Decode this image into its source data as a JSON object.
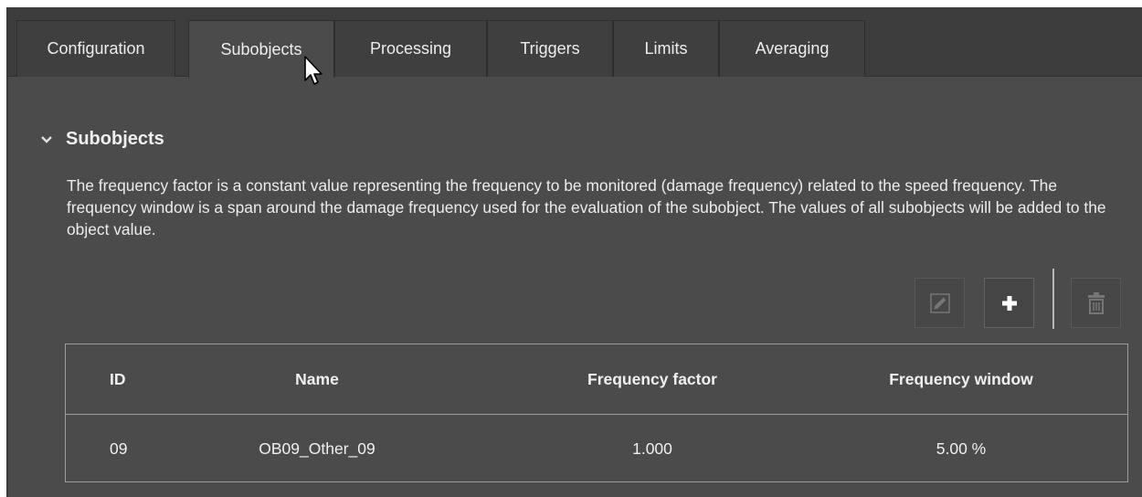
{
  "tabs": [
    {
      "label": "Configuration"
    },
    {
      "label": "Subobjects"
    },
    {
      "label": "Processing"
    },
    {
      "label": "Triggers"
    },
    {
      "label": "Limits"
    },
    {
      "label": "Averaging"
    }
  ],
  "active_tab": "Subobjects",
  "section": {
    "title": "Subobjects",
    "description": "The frequency factor is a constant value representing the frequency to be monitored (damage frequency) related to the speed frequency. The frequency window is a span around the damage frequency used for the evaluation of the subobject. The values of all subobjects will be added to the object value."
  },
  "toolbar": {
    "edit_icon": "pencil-icon",
    "add_icon": "plus-icon",
    "delete_icon": "trash-icon"
  },
  "table": {
    "headers": {
      "id": "ID",
      "name": "Name",
      "frequency_factor": "Frequency factor",
      "frequency_window": "Frequency window"
    },
    "rows": [
      {
        "id": "09",
        "name": "OB09_Other_09",
        "frequency_factor": "1.000",
        "frequency_window": "5.00 %"
      }
    ]
  },
  "colors": {
    "background": "#4b4b4b",
    "tabbar": "#3d3d3d",
    "text": "#e6e6e6",
    "border": "#9c9c9c"
  }
}
